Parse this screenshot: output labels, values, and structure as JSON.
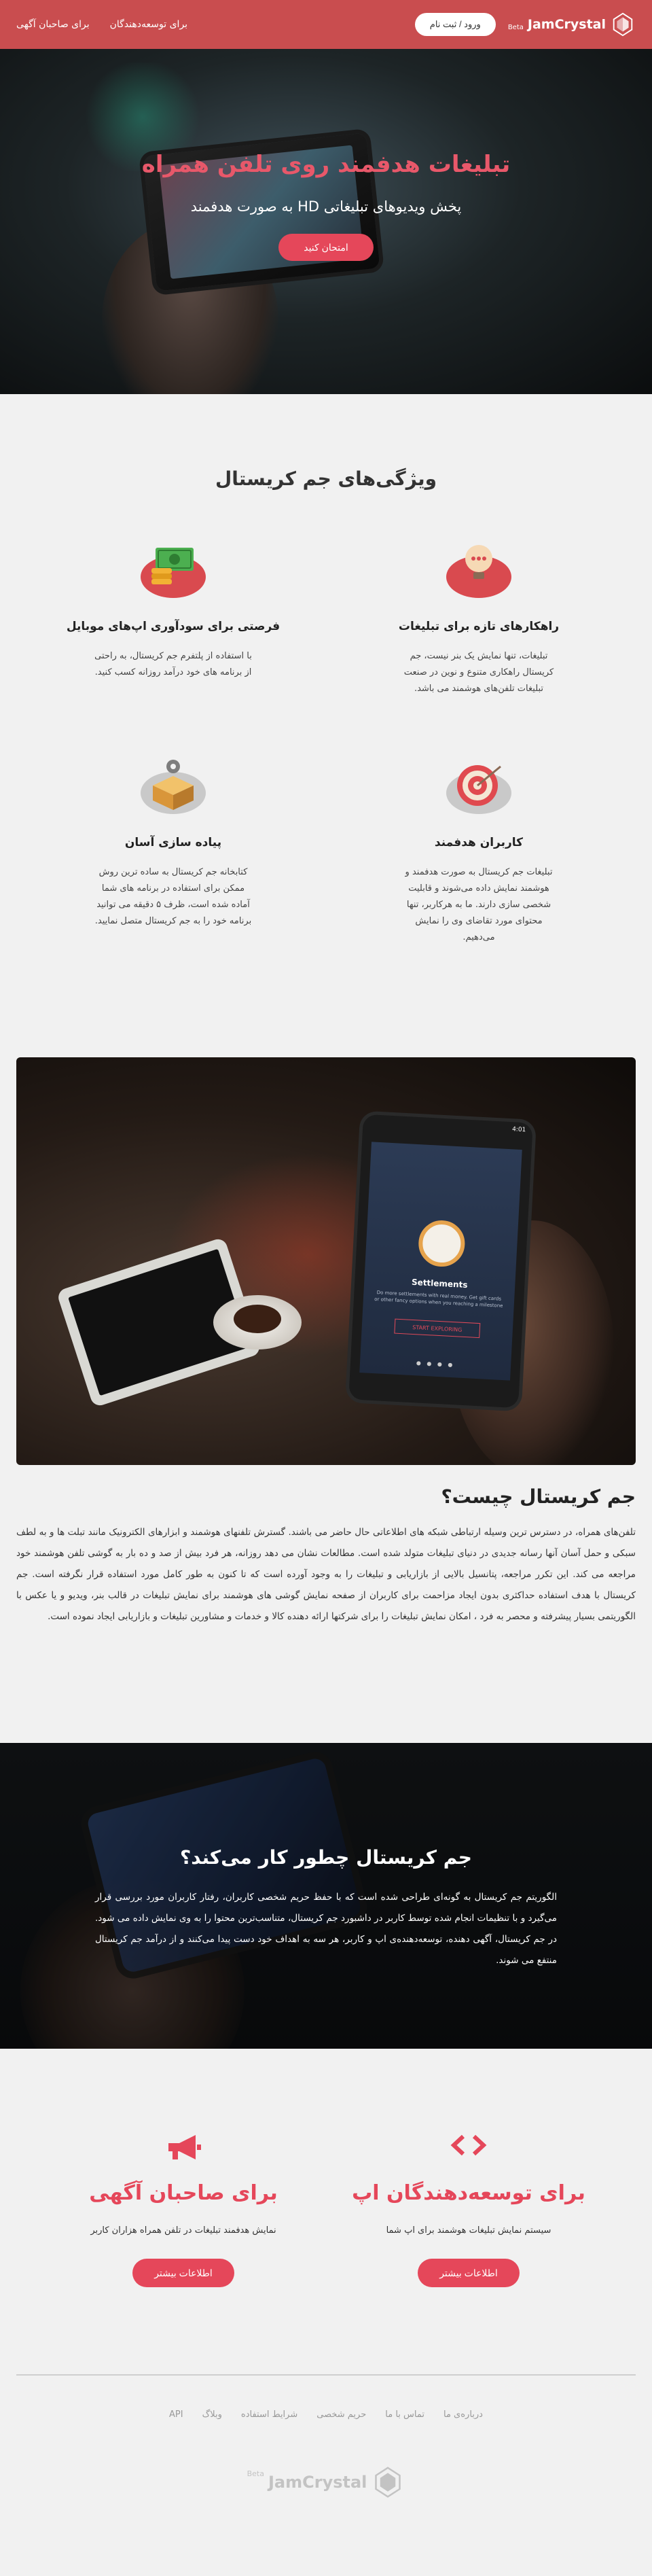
{
  "navbar": {
    "brand_name": "JamCrystal",
    "brand_beta": "Beta",
    "login_label": "ورود / ثبت نام",
    "links": [
      "برای توسعه‌دهندگان",
      "برای صاحبان آگهی"
    ]
  },
  "hero": {
    "title": "تبلیغات هدفمند روی تلفن همراه",
    "subtitle": "پخش ویدیوهای تبلیغاتی HD به صورت هدفمند",
    "cta_label": "امتحان کنید"
  },
  "features": {
    "title": "ویژگی‌های جم کریستال",
    "items": [
      {
        "icon": "lightbulb-icon",
        "title": "راهکارهای تازه برای تبلیغات",
        "text": "تبلیغات، تنها نمایش یک بنر نیست، جم کریستال راهکاری متنوع و نوین در صنعت تبلیغات تلفن‌های هوشمند می باشد."
      },
      {
        "icon": "money-stack-icon",
        "title": "فرصتی برای سودآوری اپ‌های موبایل",
        "text": "با استفاده از پلتفرم جم کریستال، به راحتی از برنامه های خود درآمد روزانه کسب کنید."
      },
      {
        "icon": "target-icon",
        "title": "کاربران هدفمند",
        "text": "تبلیغات جم کریستال به صورت هدفمند و هوشمند نمایش داده می‌شوند و قابلیت شخصی سازی دارند. ما به هرکاربر، تنها محتوای مورد تقاضای وی را نمایش می‌دهیم."
      },
      {
        "icon": "gear-box-icon",
        "title": "پیاده سازی آسان",
        "text": "کتابخانه جم کریستال به ساده ترین روش ممکن برای استفاده در برنامه های شما آماده شده است، ظرف ۵ دقیقه می توانید برنامه خود را به جم کریستال متصل نمایید."
      }
    ]
  },
  "about": {
    "phone_status": "4:01",
    "screen_title": "Settlements",
    "screen_desc": "Do more settlements with real money. Get gift cards or other fancy options when you reaching a milestone",
    "screen_button": "START EXPLORING",
    "title": "جم کریستال چیست؟",
    "text": "تلفن‌های همراه، در دسترس ترین وسیله ارتباطی شبکه های اطلاعاتی حال حاضر می باشند. گسترش تلفنهای هوشمند و ابزارهای الکترونیک مانند تبلت ها و به لطف سبکی و حمل آسان آنها رسانه جدیدی در دنیای تبلیغات متولد شده است. مطالعات نشان می دهد روزانه، هر فرد بیش از صد و ده بار به گوشی تلفن هوشمند خود مراجعه می کند. این تکرر مراجعه، پتانسیل بالایی از بازاریابی و تبلیغات را به وجود آورده است که تا کنون به طور کامل مورد استفاده قرار نگرفته است. جم کریستال با هدف استفاده حداکثری بدون ایجاد مزاحمت برای کاربران از صفحه نمایش گوشی های هوشمند برای نمایش تبلیغات در قالب بنر، ویدیو و یا عکس با الگوریتمی بسیار پیشرفته و محصر به فرد ، امکان نمایش تبلیغات را برای شرکتها ارائه دهنده کالا و خدمات و مشاورین تبلیغات و بازاریابی ایجاد نموده است."
  },
  "how": {
    "title": "جم کریستال چطور کار می‌کند؟",
    "text": "الگوریتم جم کریستال به گونه‌ای طراحی شده است که با حفظ حریم شخصی کاربران، رفتار کاربران مورد بررسی قرار می‌گیرد و با تنظیمات انجام شده توسط کاربر در داشبورد جم کریستال، متناسب‌ترین محتوا را به وی نمایش داده می شود. در جم کریستال، آگهی دهنده، توسعه‌دهنده‌ی اپ و کاربر، هر سه به اهداف خود دست پیدا می‌کنند و از درآمد جم کریستال منتفع می شوند."
  },
  "audiences": {
    "items": [
      {
        "icon": "code-icon",
        "icon_glyph": "‹ ›",
        "title": "برای توسعه‌دهندگان اپ",
        "text": "سیستم نمایش تبلیغات هوشمند برای اپ شما",
        "button": "اطلاعات بیشتر"
      },
      {
        "icon": "megaphone-icon",
        "icon_glyph": "📢",
        "title": "برای صاحبان آگهی",
        "text": "نمایش هدفمند تبلیغات در تلفن همراه هزاران کاربر",
        "button": "اطلاعات بیشتر"
      }
    ]
  },
  "footer": {
    "links": [
      "درباره‌ی ما",
      "تماس با ما",
      "حریم شخصی",
      "شرایط استفاده",
      "وبلاگ",
      "API"
    ],
    "brand_name": "JamCrystal",
    "brand_beta": "Beta"
  },
  "colors": {
    "navbar": "#c94d4f",
    "accent": "#e5475a",
    "background": "#f1f1f1"
  }
}
